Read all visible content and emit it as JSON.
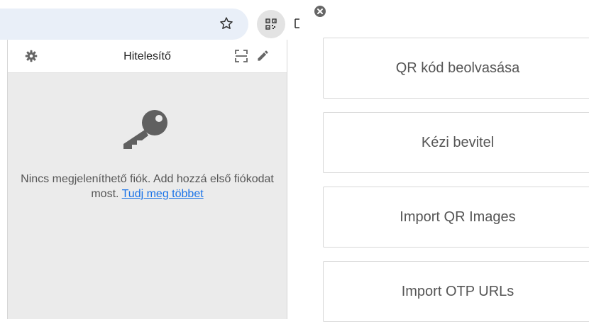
{
  "popup": {
    "title": "Hitelesítő",
    "empty_message": "Nincs megjeleníthető fiók. Add hozzá első fiókodat most.",
    "learn_more_link": "Tudj meg többet"
  },
  "add_account_menu": {
    "options": [
      "QR kód beolvasása",
      "Kézi bevitel",
      "Import QR Images",
      "Import OTP URLs"
    ]
  },
  "icons": {
    "toolbar": [
      "star-icon",
      "qr-extension-icon"
    ],
    "popup": [
      "gear-icon",
      "scan-qr-icon",
      "pencil-icon",
      "key-icon"
    ],
    "menu": [
      "close-icon"
    ]
  },
  "colors": {
    "omnibox_bg": "#e9eff8",
    "popup_bg": "#ebebeb",
    "link": "#1a73e8",
    "icon_gray": "#666666"
  }
}
